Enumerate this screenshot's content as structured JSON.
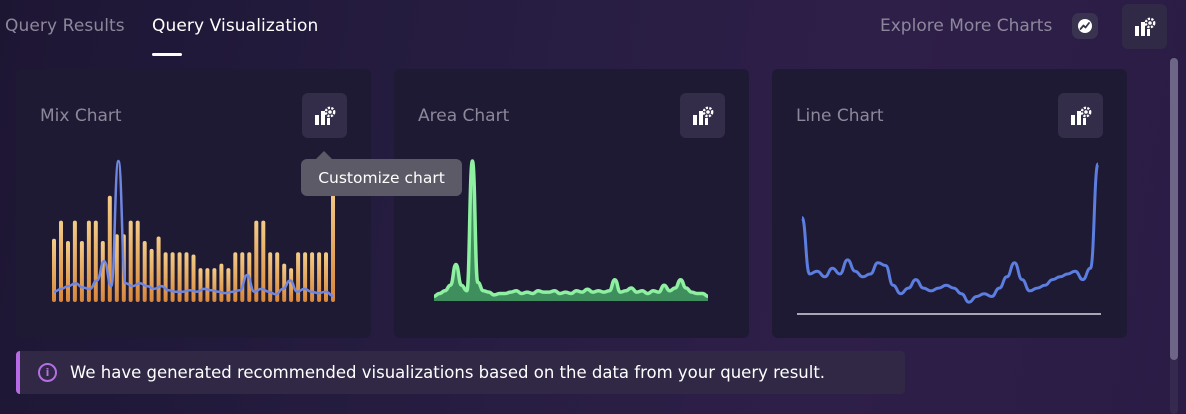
{
  "tabs": [
    {
      "label": "Query Results",
      "active": false
    },
    {
      "label": "Query Visualization",
      "active": true
    }
  ],
  "header": {
    "explore_label": "Explore More Charts",
    "explore_icon": "trend-chart-icon",
    "settings_icon": "chart-settings-icon"
  },
  "cards": [
    {
      "title": "Mix Chart",
      "settings_icon": "chart-settings-icon"
    },
    {
      "title": "Area Chart",
      "settings_icon": "chart-settings-icon"
    },
    {
      "title": "Line Chart",
      "settings_icon": "chart-settings-icon"
    }
  ],
  "tooltip": {
    "text": "Customize chart"
  },
  "info": {
    "icon": "info-icon",
    "text": "We have generated recommended visualizations based on the data from your query result.",
    "accent": "#b76ae6"
  },
  "colors": {
    "bar_top": "#f0c27b",
    "bar_bottom": "#d98a3e",
    "mix_line": "#6f86e0",
    "area_stroke": "#8ef0a0",
    "area_fill": "#3f8f5e",
    "line_stroke": "#5b7ee0"
  },
  "chart_data": [
    {
      "type": "bar",
      "name": "Mix Chart",
      "bars": [
        0.56,
        0.72,
        0.54,
        0.72,
        0.54,
        0.72,
        0.72,
        0.54,
        0.94,
        0.6,
        0.6,
        0.72,
        0.72,
        0.54,
        0.47,
        0.58,
        0.44,
        0.44,
        0.44,
        0.44,
        0.42,
        0.3,
        0.3,
        0.3,
        0.34,
        0.3,
        0.44,
        0.44,
        0.44,
        0.72,
        0.72,
        0.44,
        0.44,
        0.34,
        0.3,
        0.44,
        0.44,
        0.44,
        0.44,
        0.44,
        1.0
      ],
      "line": [
        0.06,
        0.08,
        0.1,
        0.12,
        0.09,
        0.08,
        0.14,
        0.28,
        0.1,
        1.0,
        0.12,
        0.1,
        0.12,
        0.1,
        0.08,
        0.1,
        0.07,
        0.06,
        0.06,
        0.07,
        0.06,
        0.08,
        0.07,
        0.06,
        0.05,
        0.06,
        0.07,
        0.18,
        0.06,
        0.08,
        0.06,
        0.04,
        0.08,
        0.14,
        0.06,
        0.08,
        0.06,
        0.05,
        0.06,
        0.03
      ]
    },
    {
      "type": "area",
      "name": "Area Chart",
      "values": [
        0.02,
        0.04,
        0.06,
        0.1,
        0.25,
        0.1,
        0.06,
        1.0,
        0.12,
        0.06,
        0.05,
        0.03,
        0.04,
        0.04,
        0.05,
        0.06,
        0.04,
        0.05,
        0.04,
        0.06,
        0.05,
        0.05,
        0.06,
        0.04,
        0.05,
        0.04,
        0.06,
        0.05,
        0.07,
        0.05,
        0.06,
        0.05,
        0.06,
        0.14,
        0.05,
        0.06,
        0.08,
        0.05,
        0.06,
        0.04,
        0.06,
        0.05,
        0.1,
        0.06,
        0.08,
        0.14,
        0.08,
        0.05,
        0.04,
        0.04,
        0.02
      ]
    },
    {
      "type": "line",
      "name": "Line Chart",
      "values": [
        0.62,
        0.22,
        0.24,
        0.2,
        0.26,
        0.22,
        0.32,
        0.24,
        0.2,
        0.22,
        0.3,
        0.28,
        0.14,
        0.08,
        0.12,
        0.18,
        0.12,
        0.1,
        0.12,
        0.14,
        0.12,
        0.08,
        0.02,
        0.06,
        0.08,
        0.06,
        0.12,
        0.2,
        0.3,
        0.18,
        0.1,
        0.12,
        0.14,
        0.18,
        0.2,
        0.22,
        0.24,
        0.18,
        0.26,
        1.0
      ]
    }
  ]
}
